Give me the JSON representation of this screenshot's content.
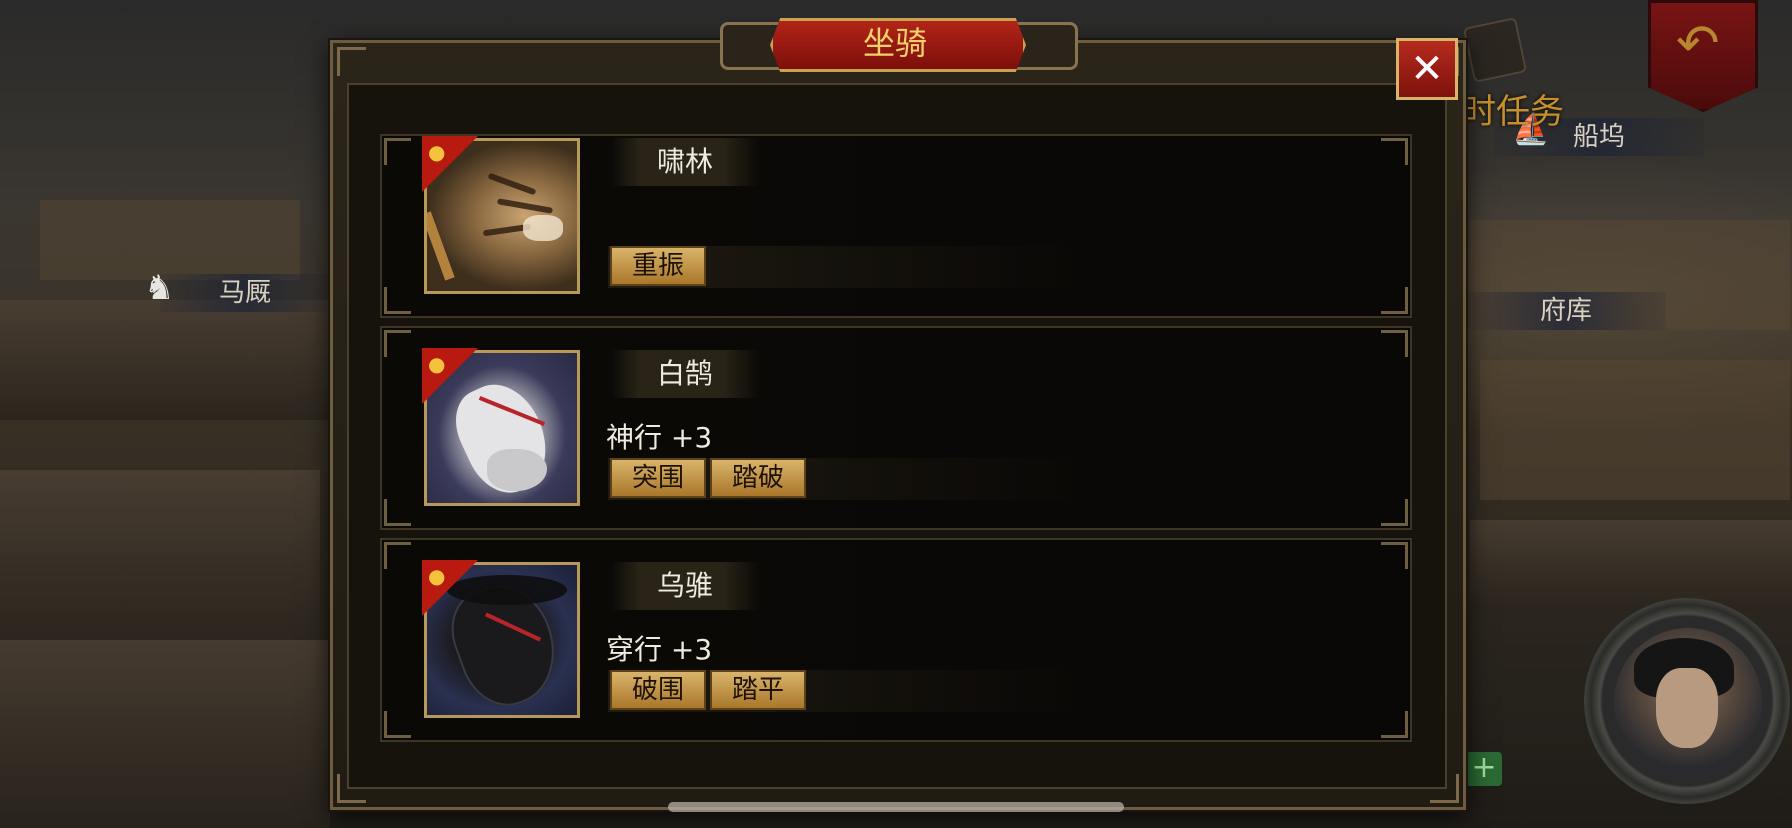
{
  "dialog": {
    "title": "坐骑",
    "close_label": "✕"
  },
  "background": {
    "quest_label": "时任务",
    "signs": {
      "stable": "马厩",
      "dock": "船坞",
      "treasury": "府库"
    }
  },
  "mounts": [
    {
      "name": "啸林",
      "attribute": "",
      "tags": [
        "重振"
      ],
      "thumbnail": "tiger"
    },
    {
      "name": "白鹄",
      "attribute": "神行 +3",
      "tags": [
        "突围",
        "踏破"
      ],
      "thumbnail": "white-horse"
    },
    {
      "name": "乌骓",
      "attribute": "穿行 +3",
      "tags": [
        "破围",
        "踏平"
      ],
      "thumbnail": "black-horse"
    }
  ],
  "colors": {
    "title_red": "#b32418",
    "gold": "#d9b46b",
    "badge_red": "#b81a10",
    "badge_icon": "#f4c23c"
  }
}
